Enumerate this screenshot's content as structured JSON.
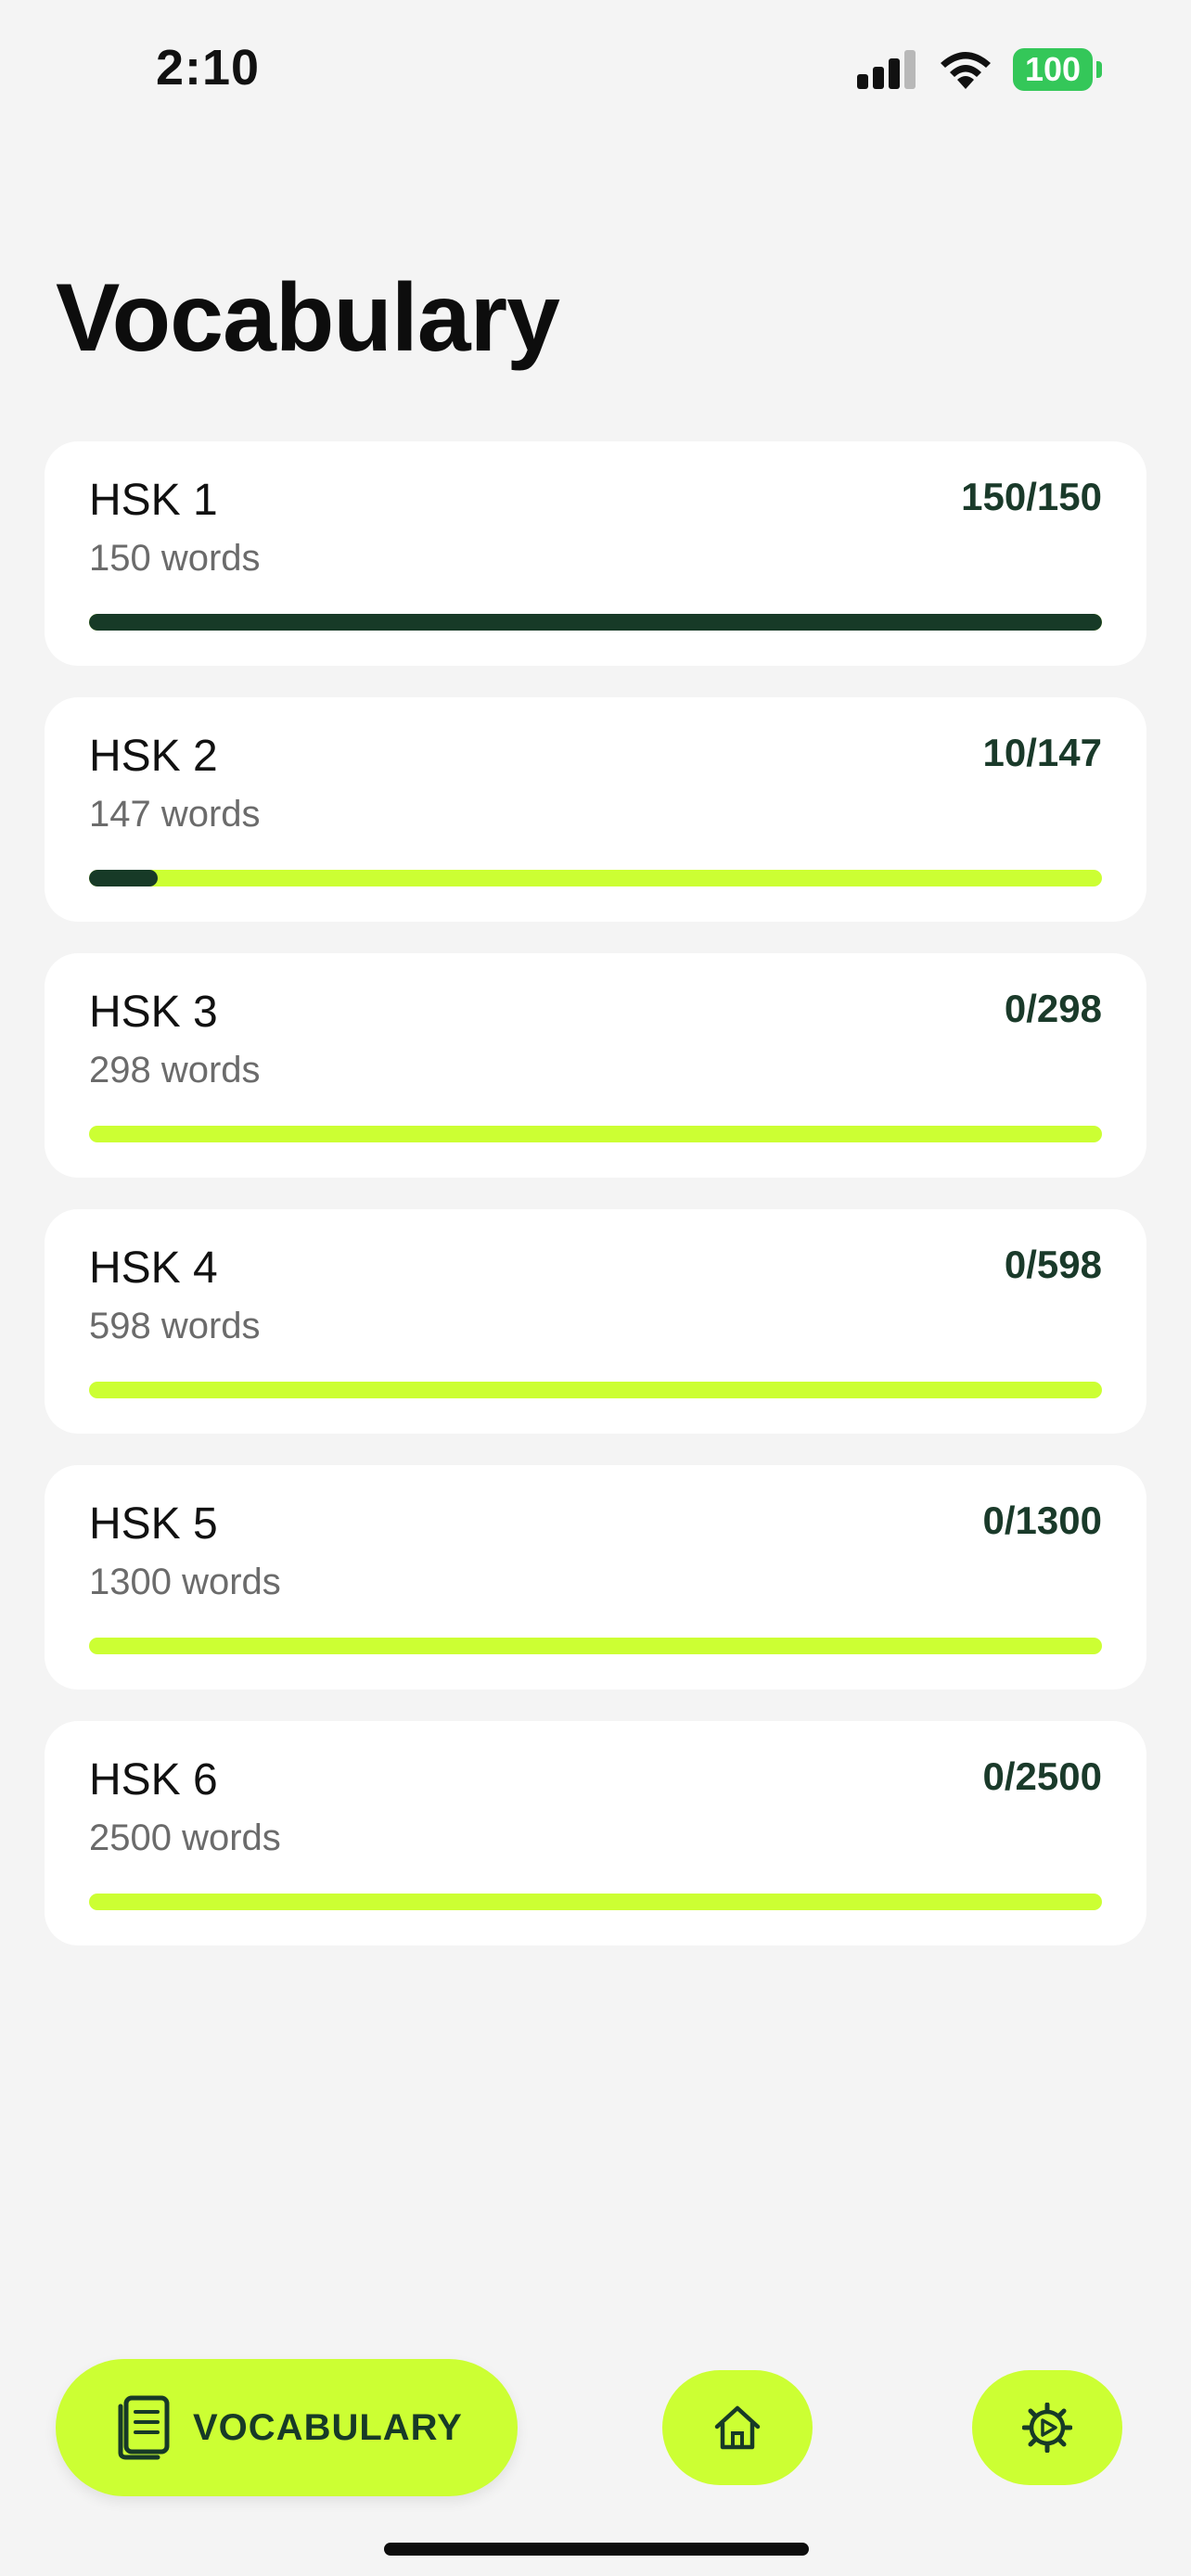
{
  "status_bar": {
    "time": "2:10",
    "battery": "100",
    "colors": {
      "battery": "#34c759"
    },
    "icons": [
      "signal-icon",
      "wifi-icon",
      "battery-icon"
    ]
  },
  "page": {
    "title": "Vocabulary"
  },
  "levels": [
    {
      "name": "HSK 1",
      "count": "150 words",
      "progress_text": "150/150",
      "progress": 1.0
    },
    {
      "name": "HSK 2",
      "count": "147 words",
      "progress_text": "10/147",
      "progress": 0.068
    },
    {
      "name": "HSK 3",
      "count": "298 words",
      "progress_text": "0/298",
      "progress": 0
    },
    {
      "name": "HSK 4",
      "count": "598 words",
      "progress_text": "0/598",
      "progress": 0
    },
    {
      "name": "HSK 5",
      "count": "1300 words",
      "progress_text": "0/1300",
      "progress": 0
    },
    {
      "name": "HSK 6",
      "count": "2500 words",
      "progress_text": "0/2500",
      "progress": 0
    }
  ],
  "nav": {
    "vocabulary_label": "VOCABULARY",
    "icons": [
      "book-icon",
      "home-icon",
      "settings-icon"
    ]
  },
  "colors": {
    "accent": "#ccff33",
    "progress_fill": "#173a27",
    "background": "#f4f4f4",
    "card": "#ffffff"
  }
}
